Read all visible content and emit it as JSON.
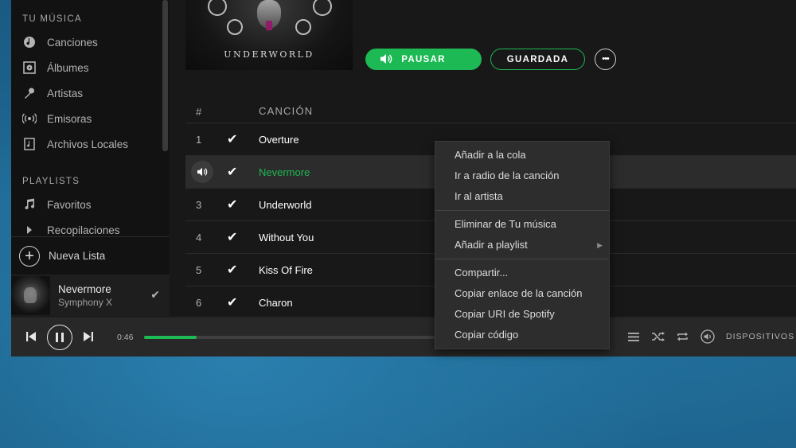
{
  "sidebar": {
    "section_music": "TU MÚSICA",
    "items": [
      {
        "label": "Canciones",
        "icon": "songs-icon"
      },
      {
        "label": "Álbumes",
        "icon": "album-icon"
      },
      {
        "label": "Artistas",
        "icon": "microphone-icon"
      },
      {
        "label": "Emisoras",
        "icon": "radio-icon"
      },
      {
        "label": "Archivos Locales",
        "icon": "local-files-icon"
      }
    ],
    "section_playlists": "PLAYLISTS",
    "playlists": [
      {
        "label": "Favoritos",
        "icon": "music-note-icon"
      },
      {
        "label": "Recopilaciones",
        "icon": "caret-right-icon"
      }
    ],
    "new_list": "Nueva Lista",
    "now_playing": {
      "title": "Nevermore",
      "artist": "Symphony X"
    }
  },
  "album": {
    "cover_text": "UNDERWORLD",
    "pause_label": "PAUSAR",
    "saved_label": "GUARDADA",
    "more_label": "•••"
  },
  "table": {
    "col_num": "#",
    "col_song": "CANCIÓN",
    "rows": [
      {
        "num": "1",
        "title": "Overture",
        "saved": true
      },
      {
        "num": "2",
        "title": "Nevermore",
        "saved": true,
        "playing": true
      },
      {
        "num": "3",
        "title": "Underworld",
        "saved": true
      },
      {
        "num": "4",
        "title": "Without You",
        "saved": true
      },
      {
        "num": "5",
        "title": "Kiss Of Fire",
        "saved": true
      },
      {
        "num": "6",
        "title": "Charon",
        "saved": true
      }
    ]
  },
  "player": {
    "elapsed": "0:46",
    "progress_fraction": 0.18,
    "devices_label": "DISPOSITIVOS DISPONIBLES"
  },
  "context_menu": {
    "group1": [
      "Añadir a la cola",
      "Ir a radio de la canción",
      "Ir al artista"
    ],
    "group2": [
      "Eliminar de Tu música",
      "Añadir a playlist"
    ],
    "group3": [
      "Compartir...",
      "Copiar enlace de la canción",
      "Copiar URI de Spotify",
      "Copiar código"
    ]
  },
  "colors": {
    "accent": "#1db954",
    "background": "#181818",
    "sidebar": "#121212",
    "menu": "#2d2d2d"
  }
}
